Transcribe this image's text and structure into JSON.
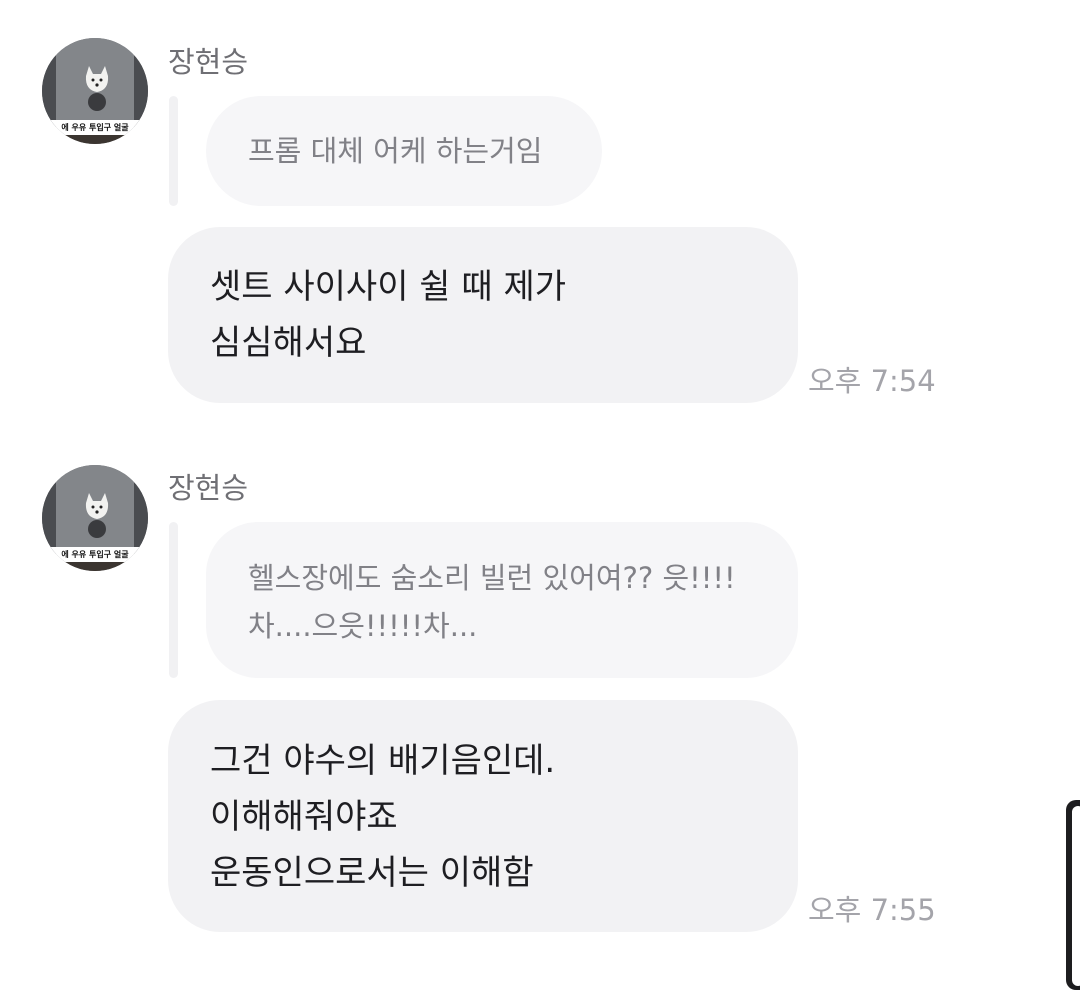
{
  "messages": [
    {
      "sender": "장현승",
      "avatar_icon": "dog-on-wall-photo-icon",
      "avatar_caption": "에 우유 투입구 얼굴",
      "quote_lines": [
        "프롬 대체 어케 하는거임"
      ],
      "body_lines": [
        "셋트 사이사이 쉴 때 제가",
        "심심해서요"
      ],
      "time": "오후 7:54"
    },
    {
      "sender": "장현승",
      "avatar_icon": "dog-on-wall-photo-icon",
      "avatar_caption": "에 우유 투입구 얼굴",
      "quote_lines": [
        "헬스장에도 숨소리 빌런 있어여?? 읏!!!!",
        "차....으읏!!!!!차..."
      ],
      "body_lines": [
        "그건 야수의 배기음인데.",
        "이해해줘야죠",
        "운동인으로서는 이해함"
      ],
      "time": "오후 7:55"
    }
  ],
  "colors": {
    "background": "#ffffff",
    "quote_bubble": "#f6f6f8",
    "message_bubble": "#f2f2f4",
    "sender_text": "#6f6f74",
    "time_text": "#a4a4aa"
  }
}
